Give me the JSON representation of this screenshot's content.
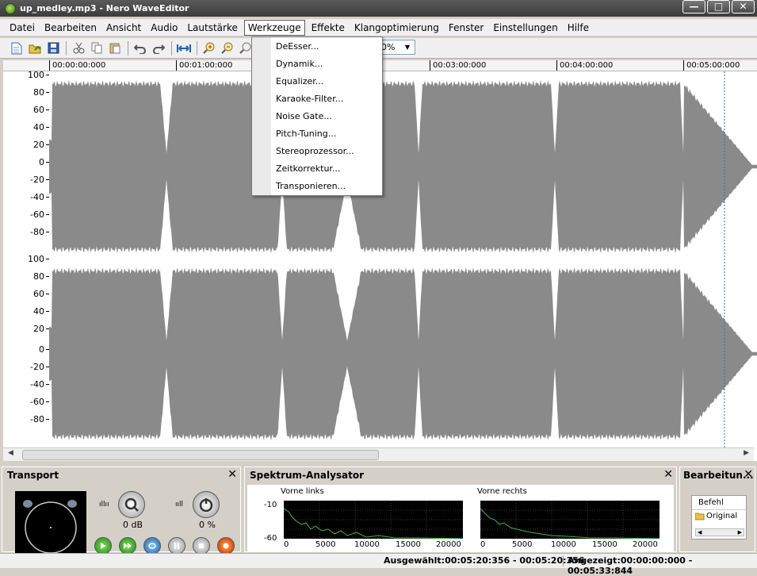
{
  "window": {
    "title": "up_medley.mp3 - Nero WaveEditor",
    "controls": [
      "—",
      "□",
      "✕"
    ]
  },
  "menubar": {
    "items": [
      "Datei",
      "Bearbeiten",
      "Ansicht",
      "Audio",
      "Lautstärke",
      "Werkzeuge",
      "Effekte",
      "Klangoptimierung",
      "Fenster",
      "Einstellungen",
      "Hilfe"
    ],
    "active": "Werkzeuge"
  },
  "toolbar": {
    "buttons": [
      "new-file",
      "open-file",
      "save",
      "cut",
      "copy",
      "paste",
      "undo",
      "redo",
      "fit-selection",
      "zoom-in",
      "zoom-out",
      "zoom-full"
    ],
    "zoom_value": "0%"
  },
  "dropdown": {
    "items": [
      "DeEsser...",
      "Dynamik...",
      "Equalizer...",
      "Karaoke-Filter...",
      "Noise Gate...",
      "Pitch-Tuning...",
      "Stereoprozessor...",
      "Zeitkorrektur...",
      "Transponieren..."
    ]
  },
  "ruler": {
    "ticks": [
      "00:00:00:000",
      "00:01:00:000",
      "00:03:00:000",
      "00:04:00:000",
      "00:05:00:000"
    ]
  },
  "yaxis": {
    "top_channel": [
      "100",
      "80",
      "60",
      "40",
      "20",
      "0",
      "-20",
      "-40",
      "-60",
      "-80"
    ],
    "bottom_channel": [
      "100",
      "80",
      "60",
      "40",
      "20",
      "0",
      "-20",
      "-40",
      "-60",
      "-80"
    ]
  },
  "transport": {
    "title": "Transport",
    "volume": "0 dB",
    "pan": "0 %",
    "buttons": [
      "play",
      "play-selection",
      "loop",
      "pause",
      "stop",
      "record"
    ]
  },
  "spectrum": {
    "title": "Spektrum-Analysator",
    "left_label": "Vorne links",
    "right_label": "Vorne rechts",
    "y_ticks": [
      "-10",
      "-60"
    ],
    "x_ticks": [
      "0",
      "5000",
      "10000",
      "15000",
      "20000"
    ]
  },
  "bearbeitung": {
    "title": "Bearbeitun...",
    "header": "Befehl",
    "item": "Original"
  },
  "status": {
    "selected": "Ausgewählt:00:05:20:356 - 00:05:20:356",
    "shown": "Angezeigt:00:00:00:000 - 00:05:33:844"
  },
  "colors": {
    "waveform": "#8a8a8a",
    "titlebar": "#4a4a4a",
    "spectrum_bg": "#000000",
    "spectrum_line": "#3cb44b"
  }
}
